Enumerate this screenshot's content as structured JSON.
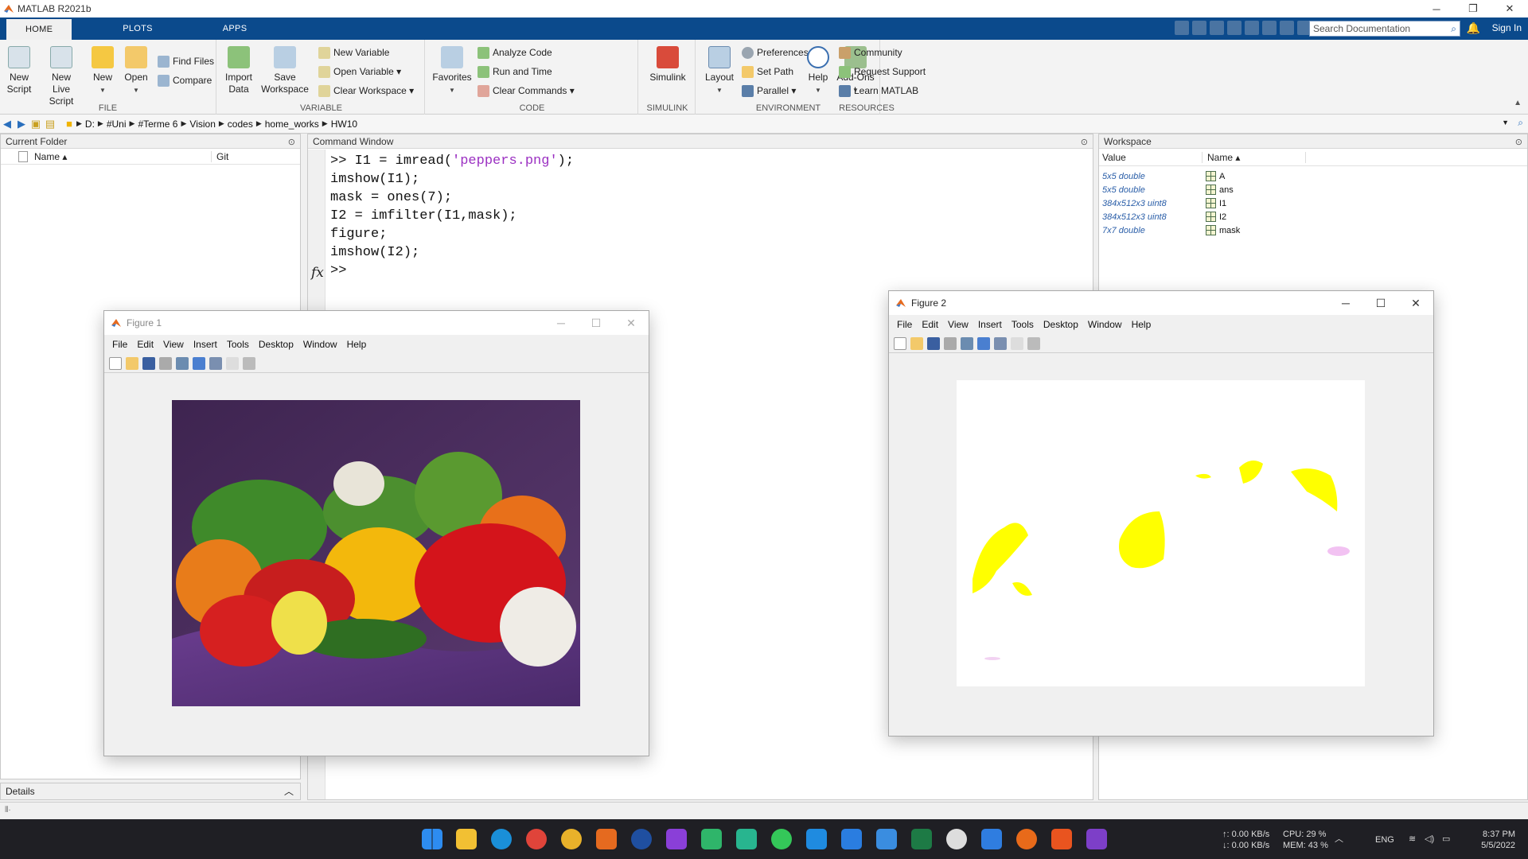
{
  "app": {
    "title": "MATLAB R2021b"
  },
  "tabs": [
    {
      "label": "HOME"
    },
    {
      "label": "PLOTS"
    },
    {
      "label": "APPS"
    }
  ],
  "search": {
    "placeholder": "Search Documentation"
  },
  "signin": "Sign In",
  "ribbon": {
    "file": {
      "label": "FILE",
      "new_script": "New\nScript",
      "new_live_script": "New\nLive Script",
      "new": "New",
      "open": "Open",
      "find_files": "Find Files",
      "compare": "Compare"
    },
    "variable": {
      "label": "VARIABLE",
      "import_data": "Import\nData",
      "save_workspace": "Save\nWorkspace",
      "new_variable": "New Variable",
      "open_variable": "Open Variable ▾",
      "clear_workspace": "Clear Workspace ▾"
    },
    "code": {
      "label": "CODE",
      "favorites": "Favorites",
      "analyze_code": "Analyze Code",
      "run_and_time": "Run and Time",
      "clear_commands": "Clear Commands ▾"
    },
    "simulink": {
      "label": "SIMULINK",
      "simulink": "Simulink"
    },
    "environment": {
      "label": "ENVIRONMENT",
      "layout": "Layout",
      "preferences": "Preferences",
      "set_path": "Set Path",
      "parallel": "Parallel ▾",
      "addons": "Add-Ons"
    },
    "resources": {
      "label": "RESOURCES",
      "help": "Help",
      "community": "Community",
      "request_support": "Request Support",
      "learn_matlab": "Learn MATLAB"
    }
  },
  "address": {
    "crumbs": [
      "D:",
      "#Uni",
      "#Terme 6",
      "Vision",
      "codes",
      "home_works",
      "HW10"
    ]
  },
  "current_folder": {
    "title": "Current Folder",
    "col_name": "Name ▴",
    "col_git": "Git"
  },
  "command_window": {
    "title": "Command Window",
    "prompt": ">> ",
    "line1_pre": "I1 = imread(",
    "line1_str": "'peppers.png'",
    "line1_post": ");",
    "lines": [
      "imshow(I1);",
      "mask = ones(7);",
      "I2 = imfilter(I1,mask);",
      "figure;",
      "imshow(I2);"
    ],
    "fx": "fx",
    "empty_prompt": ">>"
  },
  "workspace": {
    "title": "Workspace",
    "col_value": "Value",
    "col_name": "Name ▴",
    "rows": [
      {
        "value": "5x5 double",
        "name": "A"
      },
      {
        "value": "5x5 double",
        "name": "ans"
      },
      {
        "value": "384x512x3 uint8",
        "name": "I1"
      },
      {
        "value": "384x512x3 uint8",
        "name": "I2"
      },
      {
        "value": "7x7 double",
        "name": "mask"
      }
    ]
  },
  "details": {
    "label": "Details"
  },
  "figure1": {
    "title": "Figure 1",
    "menu": [
      "File",
      "Edit",
      "View",
      "Insert",
      "Tools",
      "Desktop",
      "Window",
      "Help"
    ]
  },
  "figure2": {
    "title": "Figure 2",
    "menu": [
      "File",
      "Edit",
      "View",
      "Insert",
      "Tools",
      "Desktop",
      "Window",
      "Help"
    ]
  },
  "tray": {
    "net_up": "↑: 0.00 KB/s",
    "net_down": "↓: 0.00 KB/s",
    "cpu": "CPU: 29 %",
    "mem": "MEM: 43 %",
    "lang": "ENG",
    "time": "8:37 PM",
    "date": "5/5/2022"
  }
}
